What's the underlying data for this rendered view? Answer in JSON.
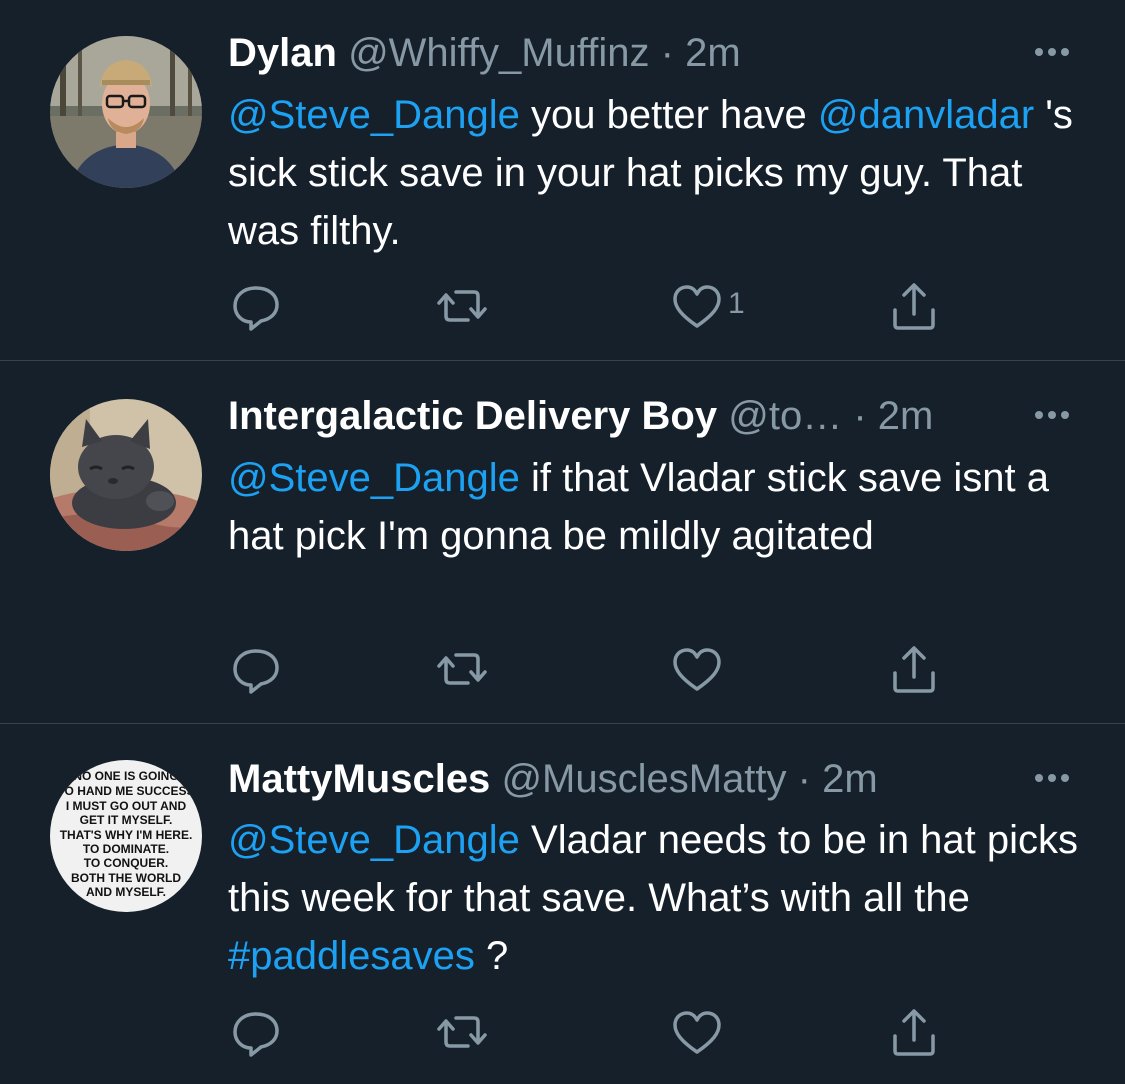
{
  "tweets": [
    {
      "name": "Dylan",
      "handle": "@Whiffy_Muffinz",
      "separator": "·",
      "time": "2m",
      "text": {
        "m1": "@Steve_Dangle",
        "t1": " you better have ",
        "m2": "@danvladar",
        "t2": " 's sick stick save in your hat picks my guy. That was filthy."
      },
      "likes": "1"
    },
    {
      "name": "Intergalactic Delivery Boy",
      "handle": "@to…",
      "separator": "·",
      "time": "2m",
      "text": {
        "m1": "@Steve_Dangle",
        "t1": " if that Vladar stick save isnt a hat pick I'm gonna be mildly agitated"
      }
    },
    {
      "name": "MattyMuscles",
      "handle": "@MusclesMatty",
      "separator": "·",
      "time": "2m",
      "text": {
        "m1": "@Steve_Dangle",
        "t1": " Vladar needs to be in hat picks this week for that save. What’s with all the ",
        "h1": "#paddlesaves",
        "t2": " ?"
      },
      "avatar_text": [
        "NO ONE IS GOING",
        "TO HAND ME SUCCESS",
        "I MUST GO OUT AND",
        "GET IT MYSELF.",
        "THAT'S WHY I'M HERE.",
        "TO DOMINATE.",
        "TO CONQUER.",
        "BOTH THE WORLD",
        "AND MYSELF."
      ]
    }
  ],
  "colors": {
    "background": "#15202b",
    "text": "#ffffff",
    "secondary": "#8899a6",
    "link": "#1da1f2",
    "divider": "#38444d"
  },
  "icons": [
    "reply-icon",
    "retweet-icon",
    "like-icon",
    "share-icon",
    "more-icon"
  ]
}
